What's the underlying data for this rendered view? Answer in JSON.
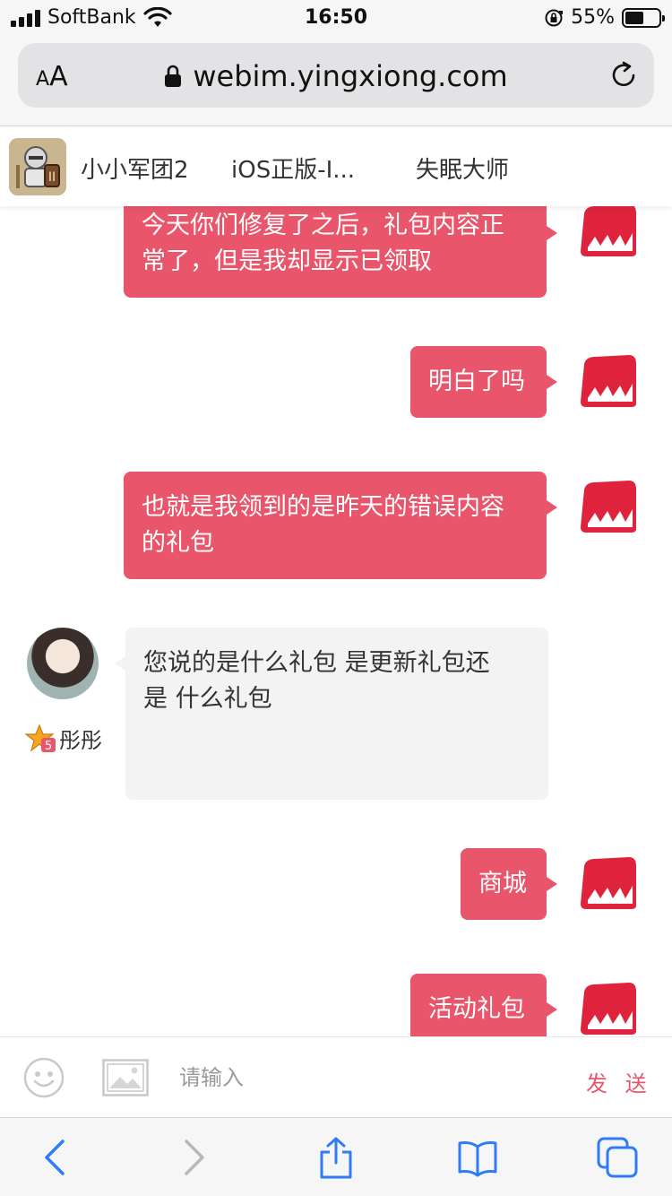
{
  "status_bar": {
    "carrier": "SoftBank",
    "time": "16:50",
    "battery_percent": "55%",
    "battery_level": 0.55
  },
  "address_bar": {
    "text_size_label": "AA",
    "url": "webim.yingxiong.com"
  },
  "tabs": [
    {
      "label": "小小军团2"
    },
    {
      "label": "iOS正版-I..."
    },
    {
      "label": "失眠大师"
    }
  ],
  "chat": {
    "messages": [
      {
        "from": "agent",
        "text_lines": [
          "今天你们修复了之后，礼包内容正",
          "常了，但是我却显示已领取"
        ]
      },
      {
        "from": "agent",
        "text_lines": [
          "明白了吗"
        ]
      },
      {
        "from": "agent",
        "text_lines": [
          "也就是我领到的是昨天的错误内容",
          "的礼包"
        ]
      },
      {
        "from": "user",
        "name": "彤彤",
        "badge_level": "5",
        "text_lines": [
          "您说的是什么礼包  是更新礼包还",
          "是  什么礼包"
        ]
      },
      {
        "from": "agent",
        "text_lines": [
          "商城"
        ]
      },
      {
        "from": "agent",
        "text_lines": [
          "活动礼包"
        ]
      }
    ]
  },
  "input_bar": {
    "placeholder": "请输入",
    "send_label": "发 送"
  },
  "colors": {
    "accent": "#e9566b",
    "incoming_bubble": "#f3f3f3",
    "toolbar_blue": "#2f7cf6"
  },
  "icons": {
    "emoji": "smiley-icon",
    "image": "image-icon",
    "back": "chevron-left-icon",
    "forward": "chevron-right-icon",
    "share": "share-icon",
    "bookmarks": "book-icon",
    "tabs": "tabs-icon"
  }
}
